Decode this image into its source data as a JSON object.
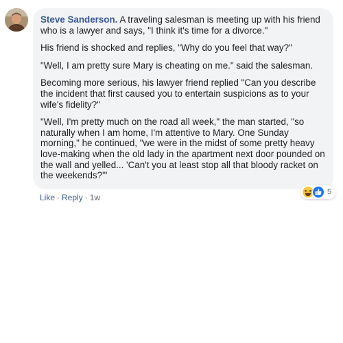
{
  "comment": {
    "author": "Steve Sanderson.",
    "paragraphs": [
      "A traveling salesman is meeting up with his friend who is a lawyer and says, \"I think it's time for a divorce.\"",
      "His friend is shocked and replies, \"Why do you feel that way?\"",
      "\"Well, I am pretty sure Mary is cheating on me.\" said the salesman.",
      "Becoming more serious, his lawyer friend replied \"Can you describe the incident that first caused you to entertain suspicions as to your wife's fidelity?\"",
      "\"Well, I'm pretty much on the road all week,\" the man started, \"so naturally when I am home, I'm attentive to Mary. One Sunday morning,\" he continued, \"we were in the midst of some pretty heavy love-making when the old lady in the apartment next door pounded on the wall and yelled... 'Can't you at least stop all that bloody racket on the weekends?'\""
    ]
  },
  "reactions": {
    "icons": [
      "haha-icon",
      "like-icon"
    ],
    "count": "5"
  },
  "actions": {
    "like": "Like",
    "reply": "Reply",
    "time": "1w",
    "separator": "·"
  },
  "colors": {
    "author_link": "#385898",
    "bubble_bg": "#f2f3f5",
    "like_blue": "#1877f2",
    "haha_yellow": "#f7c93e"
  }
}
